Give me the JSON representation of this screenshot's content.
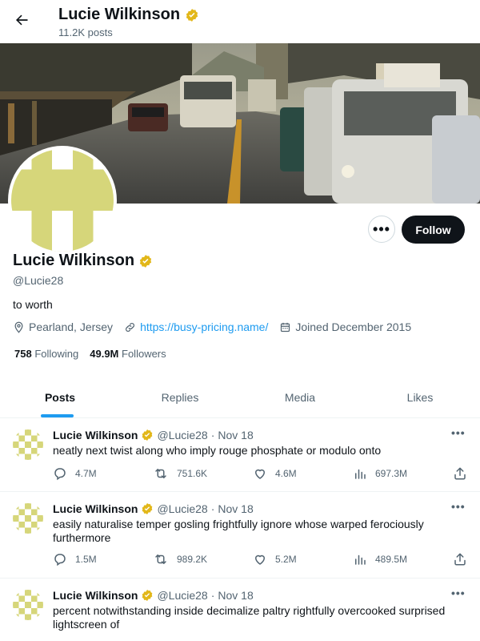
{
  "header": {
    "name": "Lucie Wilkinson",
    "posts_count": "11.2K posts"
  },
  "profile": {
    "name": "Lucie Wilkinson",
    "handle": "@Lucie28",
    "bio": "to worth",
    "location": "Pearland, Jersey",
    "website": "https://busy-pricing.name/",
    "joined": "Joined December 2015",
    "following_count": "758",
    "following_label": "Following",
    "followers_count": "49.9M",
    "followers_label": "Followers",
    "follow_button": "Follow",
    "more_button": "•••"
  },
  "tabs": [
    {
      "label": "Posts",
      "active": true
    },
    {
      "label": "Replies",
      "active": false
    },
    {
      "label": "Media",
      "active": false
    },
    {
      "label": "Likes",
      "active": false
    }
  ],
  "posts": [
    {
      "name": "Lucie Wilkinson",
      "handle": "@Lucie28",
      "dot": "·",
      "date": "Nov 18",
      "text": "neatly next twist along who imply rouge phosphate or modulo onto",
      "replies": "4.7M",
      "reposts": "751.6K",
      "likes": "4.6M",
      "views": "697.3M"
    },
    {
      "name": "Lucie Wilkinson",
      "handle": "@Lucie28",
      "dot": "·",
      "date": "Nov 18",
      "text": "easily naturalise temper gosling frightfully ignore whose warped ferociously furthermore",
      "replies": "1.5M",
      "reposts": "989.2K",
      "likes": "5.2M",
      "views": "489.5M"
    },
    {
      "name": "Lucie Wilkinson",
      "handle": "@Lucie28",
      "dot": "·",
      "date": "Nov 18",
      "text": "percent notwithstanding inside decimalize paltry rightfully overcooked surprised lightscreen of"
    }
  ],
  "icons": {
    "back": "arrow-left-icon",
    "verified": "verified-badge-icon",
    "location": "location-pin-icon",
    "link": "link-icon",
    "calendar": "calendar-icon",
    "reply": "reply-icon",
    "repost": "repost-icon",
    "like": "heart-icon",
    "views": "views-chart-icon",
    "share": "share-icon"
  },
  "colors": {
    "accent": "#1d9bf0",
    "verified": "#e2b719",
    "avatar_pattern": "#d6d67a",
    "text_primary": "#0f1419",
    "text_secondary": "#536471"
  }
}
